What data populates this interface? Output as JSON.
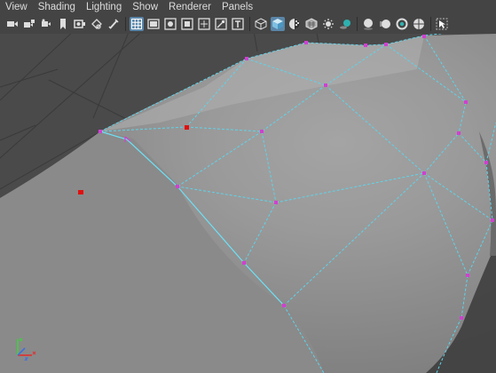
{
  "menubar": {
    "items": [
      "View",
      "Shading",
      "Lighting",
      "Show",
      "Renderer",
      "Panels"
    ]
  },
  "toolbar": {
    "icons": [
      "camera-icon",
      "camera-attributes-icon",
      "bookmark-icon",
      "image-plane-icon",
      "move-camera-icon",
      "pencil-icon",
      "grid-icon",
      "film-gate-icon",
      "resolution-gate-icon",
      "gate-mask-icon",
      "field-chart-icon",
      "safe-action-icon",
      "safe-title-icon",
      "wireframe-cube-icon",
      "smooth-shade-cube-icon",
      "default-material-icon",
      "xray-icon",
      "use-lights-icon",
      "shadows-icon",
      "ambient-occlusion-icon",
      "motion-blur-icon",
      "isolate-select-icon"
    ],
    "active_icons": [
      "grid-icon",
      "smooth-shade-cube-icon"
    ]
  },
  "colors": {
    "ui_background": "#444444",
    "menu_text": "#dcdcdc",
    "active_button": "#5a86a8",
    "wireframe": "#5fd3ea",
    "vertex": "#d040d0",
    "selected_vertex": "#e01010",
    "surface_light": "#9a9a9a",
    "surface_dark": "#3c3c3c"
  },
  "viewport": {
    "axis_gizmo": [
      "x-axis",
      "y-axis",
      "z-axis"
    ]
  }
}
